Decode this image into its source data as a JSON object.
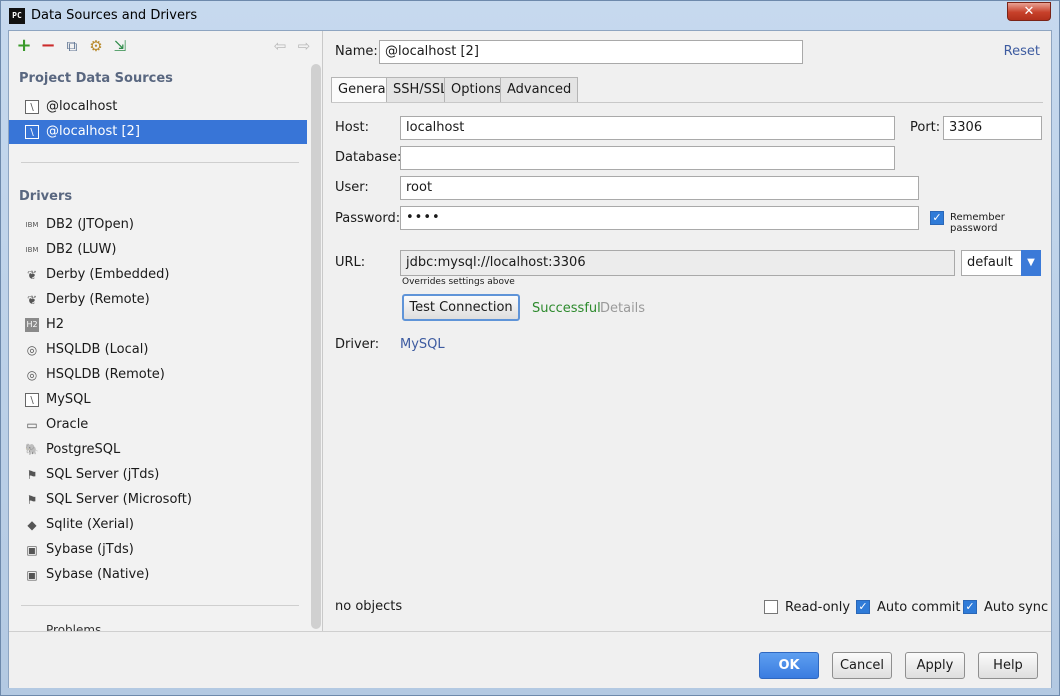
{
  "window": {
    "app_icon": "PC",
    "title": "Data Sources and Drivers",
    "close_glyph": "✕"
  },
  "toolbar": {
    "add_icon": "+",
    "remove_icon": "−",
    "copy_icon": "⧉",
    "properties_icon": "⚙",
    "import_icon": "⇲",
    "back_icon": "⇦",
    "forward_icon": "⇨"
  },
  "sidebar": {
    "project_heading": "Project Data Sources",
    "project_items": [
      {
        "label": "@localhost",
        "icon": "mysql-icon",
        "glyph": "\\"
      },
      {
        "label": "@localhost [2]",
        "icon": "mysql-icon",
        "glyph": "\\",
        "selected": true
      }
    ],
    "drivers_heading": "Drivers",
    "drivers": [
      {
        "label": "DB2 (JTOpen)",
        "icon": "ibm-icon",
        "glyph": "IBM"
      },
      {
        "label": "DB2 (LUW)",
        "icon": "ibm-icon",
        "glyph": "IBM"
      },
      {
        "label": "Derby (Embedded)",
        "icon": "derby-icon",
        "glyph": "❦"
      },
      {
        "label": "Derby (Remote)",
        "icon": "derby-icon",
        "glyph": "❦"
      },
      {
        "label": "H2",
        "icon": "h2-icon",
        "glyph": "H2"
      },
      {
        "label": "HSQLDB (Local)",
        "icon": "hsqldb-icon",
        "glyph": "◎"
      },
      {
        "label": "HSQLDB (Remote)",
        "icon": "hsqldb-icon",
        "glyph": "◎"
      },
      {
        "label": "MySQL",
        "icon": "mysql-icon",
        "glyph": "\\"
      },
      {
        "label": "Oracle",
        "icon": "oracle-icon",
        "glyph": "▭"
      },
      {
        "label": "PostgreSQL",
        "icon": "postgresql-icon",
        "glyph": "🐘"
      },
      {
        "label": "SQL Server (jTds)",
        "icon": "sqlserver-icon",
        "glyph": "⚑"
      },
      {
        "label": "SQL Server (Microsoft)",
        "icon": "sqlserver-icon",
        "glyph": "⚑"
      },
      {
        "label": "Sqlite (Xerial)",
        "icon": "sqlite-icon",
        "glyph": "◆"
      },
      {
        "label": "Sybase (jTds)",
        "icon": "sybase-icon",
        "glyph": "▣"
      },
      {
        "label": "Sybase (Native)",
        "icon": "sybase-icon",
        "glyph": "▣"
      }
    ],
    "peek_label": "Problems"
  },
  "form": {
    "name_label": "Name:",
    "name_value": "@localhost [2]",
    "reset_label": "Reset",
    "tabs": [
      {
        "label": "General",
        "active": true
      },
      {
        "label": "SSH/SSL"
      },
      {
        "label": "Options"
      },
      {
        "label": "Advanced"
      }
    ],
    "host_label": "Host:",
    "host_value": "localhost",
    "port_label": "Port:",
    "port_value": "3306",
    "database_label": "Database:",
    "database_value": "",
    "user_label": "User:",
    "user_value": "root",
    "password_label": "Password:",
    "password_value": "••••",
    "remember_password_label": "Remember password",
    "remember_password_checked": true,
    "url_label": "URL:",
    "url_value": "jdbc:mysql://localhost:3306",
    "url_hint": "Overrides settings above",
    "url_mode": "default",
    "test_connection_label": "Test Connection",
    "test_status": "Successful",
    "details_label": "Details",
    "driver_label": "Driver:",
    "driver_value": "MySQL",
    "objects_status": "no objects",
    "readonly_label": "Read-only",
    "readonly_checked": false,
    "autocommit_label": "Auto commit",
    "autocommit_checked": true,
    "autosync_label": "Auto sync",
    "autosync_checked": true
  },
  "buttons": {
    "ok": "OK",
    "cancel": "Cancel",
    "apply": "Apply",
    "help": "Help"
  },
  "colors": {
    "selection": "#3875d7",
    "success": "#2d8a2d",
    "link": "#3d5ba0",
    "primary_button": "#3a7ce0"
  }
}
